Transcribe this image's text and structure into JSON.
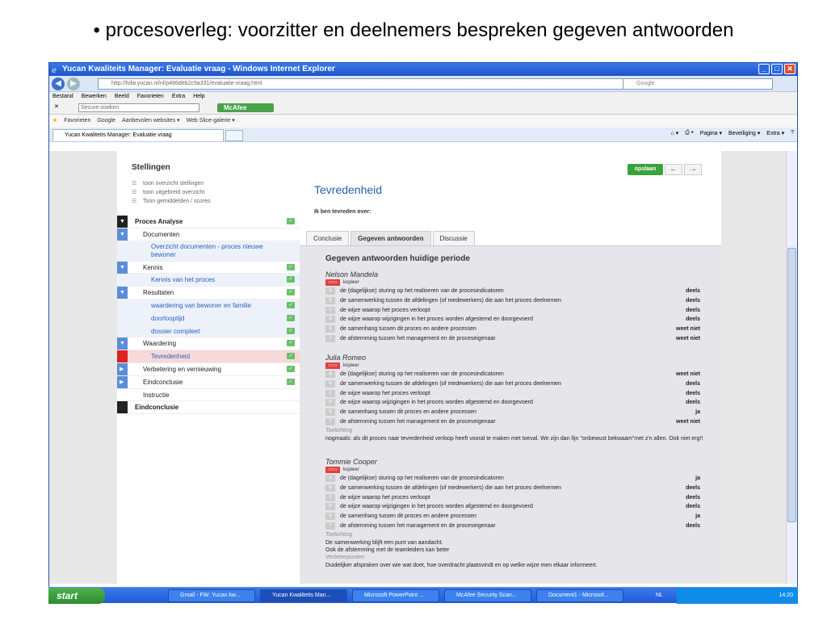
{
  "slide": {
    "title": "• procesoverleg: voorzitter en deelnemers bespreken gegeven antwoorden"
  },
  "browser": {
    "window_title": "Yucan Kwaliteits Manager: Evaluatie vraag - Windows Internet Explorer",
    "url": "http://hdw.yucan.nl/nl/p486deb2c9a331/evaluatie-vraag.html",
    "search_placeholder": "Google",
    "menu": [
      "Bestand",
      "Bewerken",
      "Beeld",
      "Favorieten",
      "Extra",
      "Help"
    ],
    "toolbar": {
      "secure_search": "Secure-zoeken",
      "mcafee": "McAfee"
    },
    "favorites": {
      "label": "Favorieten",
      "items": [
        "Google",
        "Aanbevolen websites ▾",
        "Web Slice-galerie ▾"
      ]
    },
    "tab_label": "Yucan Kwaliteits Manager: Evaluatie vraag",
    "command_bar": [
      "Pagina ▾",
      "Beveiliging ▾",
      "Extra ▾"
    ]
  },
  "sidebar": {
    "title": "Stellingen",
    "links": [
      "toon overzicht stellingen",
      "toon uitgebreid overzicht",
      "Toon gemiddelden / scores"
    ],
    "tree": [
      {
        "label": "Proces Analyse",
        "marker": "dark",
        "arrow": "▼",
        "check": true,
        "style": "bold",
        "indent": 22
      },
      {
        "label": "Documenten",
        "marker": "blue",
        "arrow": "▼",
        "check": false,
        "style": "",
        "indent": 32
      },
      {
        "label": "Overzicht documenten - proces nieuwe bewoner",
        "marker": "",
        "arrow": "",
        "check": false,
        "style": "sub",
        "indent": 42,
        "double": true
      },
      {
        "label": "Kennis",
        "marker": "blue",
        "arrow": "▼",
        "check": true,
        "style": "",
        "indent": 32
      },
      {
        "label": "Kennis van het proces",
        "marker": "",
        "arrow": "",
        "check": true,
        "style": "sub",
        "indent": 42
      },
      {
        "label": "Resultaten",
        "marker": "blue",
        "arrow": "▼",
        "check": true,
        "style": "",
        "indent": 32
      },
      {
        "label": "waardering van bewoner en familie",
        "marker": "",
        "arrow": "",
        "check": true,
        "style": "sub",
        "indent": 42
      },
      {
        "label": "doorlooptijd",
        "marker": "",
        "arrow": "",
        "check": true,
        "style": "sub",
        "indent": 42
      },
      {
        "label": "dossier compleet",
        "marker": "",
        "arrow": "",
        "check": true,
        "style": "sub",
        "indent": 42
      },
      {
        "label": "Waardering",
        "marker": "blue",
        "arrow": "▼",
        "check": true,
        "style": "",
        "indent": 32
      },
      {
        "label": "Tevredenheid",
        "marker": "red",
        "arrow": "",
        "check": true,
        "style": "active",
        "indent": 42
      },
      {
        "label": "Verbetering en vernieuwing",
        "marker": "blue",
        "arrow": "▶",
        "check": true,
        "style": "",
        "indent": 32
      },
      {
        "label": "Eindconclusie",
        "marker": "blue",
        "arrow": "▶",
        "check": true,
        "style": "",
        "indent": 32
      },
      {
        "label": "Instructie",
        "marker": "",
        "arrow": "",
        "check": false,
        "style": "",
        "indent": 32
      },
      {
        "label": "Eindconclusie",
        "marker": "dark",
        "arrow": "",
        "check": false,
        "style": "bold",
        "indent": 22
      }
    ]
  },
  "main": {
    "save_label": "opslaan",
    "title": "Tevredenheid",
    "subtitle": "Ik ben tevreden over:",
    "tabs": [
      "Conclusie",
      "Gegeven antwoorden",
      "Discussie"
    ],
    "selected_tab": "Gegeven antwoorden",
    "panel_title": "Gegeven antwoorden huidige periode",
    "copy_label": "kopieer",
    "comment_label": "Toelichting",
    "improve_label": "Verbeterpunten",
    "statements": [
      "de (dagelijkse) sturing op het realiseren van de procesindicatoren",
      "de samenwerking tussen de afdelingen (of medewerkers) die aan het proces deelnemen",
      "de wijze waarop het proces verloopt",
      "de wijze waarop wijzigingen in het proces worden afgestemd en doorgevoerd",
      "de samenhang tussen dit proces en andere processen",
      "de afstemming tussen het management en de proceseigenaar"
    ],
    "people": [
      {
        "name": "Nelson Mandela",
        "answers": [
          "deels",
          "deels",
          "deels",
          "deels",
          "weet niet",
          "weet niet"
        ],
        "comment": "",
        "improvement": ""
      },
      {
        "name": "Julia Romeo",
        "answers": [
          "weet niet",
          "deels",
          "deels",
          "deels",
          "ja",
          "weet niet"
        ],
        "comment": "nogmaals: als dit proces naar tevredenheid verloop heeft vooral te maken met toeval. We zijn dan fijn \"onbewust bekwaam\"met z'n allen. Ook niet erg!!",
        "improvement": ""
      },
      {
        "name": "Tommie Cooper",
        "answers": [
          "ja",
          "deels",
          "deels",
          "deels",
          "ja",
          "deels"
        ],
        "comment": "De samenwerking blijft een punt van aandacht.\nOok de afstemming met de teamleiders kan beter",
        "improvement": "Duidelijker afspraken over wie wat doet, hoe overdracht plaatsvindt en op welke wijze men elkaar informeert."
      }
    ]
  },
  "taskbar": {
    "start": "start",
    "tasks": [
      "Gmail - FW: Yucan kw...",
      "Yucan Kwaliteits Man...",
      "Microsoft PowerPoint ...",
      "McAfee Security Scan...",
      "Document1 - Microsof..."
    ],
    "lang": "NL",
    "clock": "14:20"
  },
  "colors": {
    "accent": "#2a5ca8",
    "save": "#3aa33a",
    "active_row": "#f6d9d9"
  }
}
